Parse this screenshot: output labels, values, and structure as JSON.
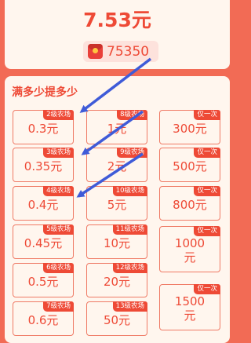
{
  "header": {
    "amount": "7.53元",
    "coins": "75350",
    "coin_icon": "red-envelope-icon"
  },
  "panel": {
    "title": "满多少提多少",
    "tiles": [
      {
        "badge": "2级农场",
        "value": "0.3元"
      },
      {
        "badge": "8级农场",
        "value": "1元"
      },
      {
        "badge": "仅一次",
        "value": "300元"
      },
      {
        "badge": "3级农场",
        "value": "0.35元"
      },
      {
        "badge": "9级农场",
        "value": "2元"
      },
      {
        "badge": "仅一次",
        "value": "500元"
      },
      {
        "badge": "4级农场",
        "value": "0.4元"
      },
      {
        "badge": "10级农场",
        "value": "5元"
      },
      {
        "badge": "仅一次",
        "value": "800元"
      },
      {
        "badge": "5级农场",
        "value": "0.45元"
      },
      {
        "badge": "11级农场",
        "value": "10元"
      },
      {
        "badge": "仅一次",
        "value": "1000\n元"
      },
      {
        "badge": "6级农场",
        "value": "0.5元"
      },
      {
        "badge": "12级农场",
        "value": "20元"
      },
      {
        "badge": "7级农场",
        "value": "0.6元"
      },
      {
        "badge": "13级农场",
        "value": "50元"
      },
      {
        "badge": "仅一次",
        "value": "1500\n元"
      }
    ]
  },
  "colors": {
    "accent": "#ee4a36",
    "background": "#f26b55",
    "card": "#fff6ee",
    "arrow": "#3f5bd8"
  }
}
